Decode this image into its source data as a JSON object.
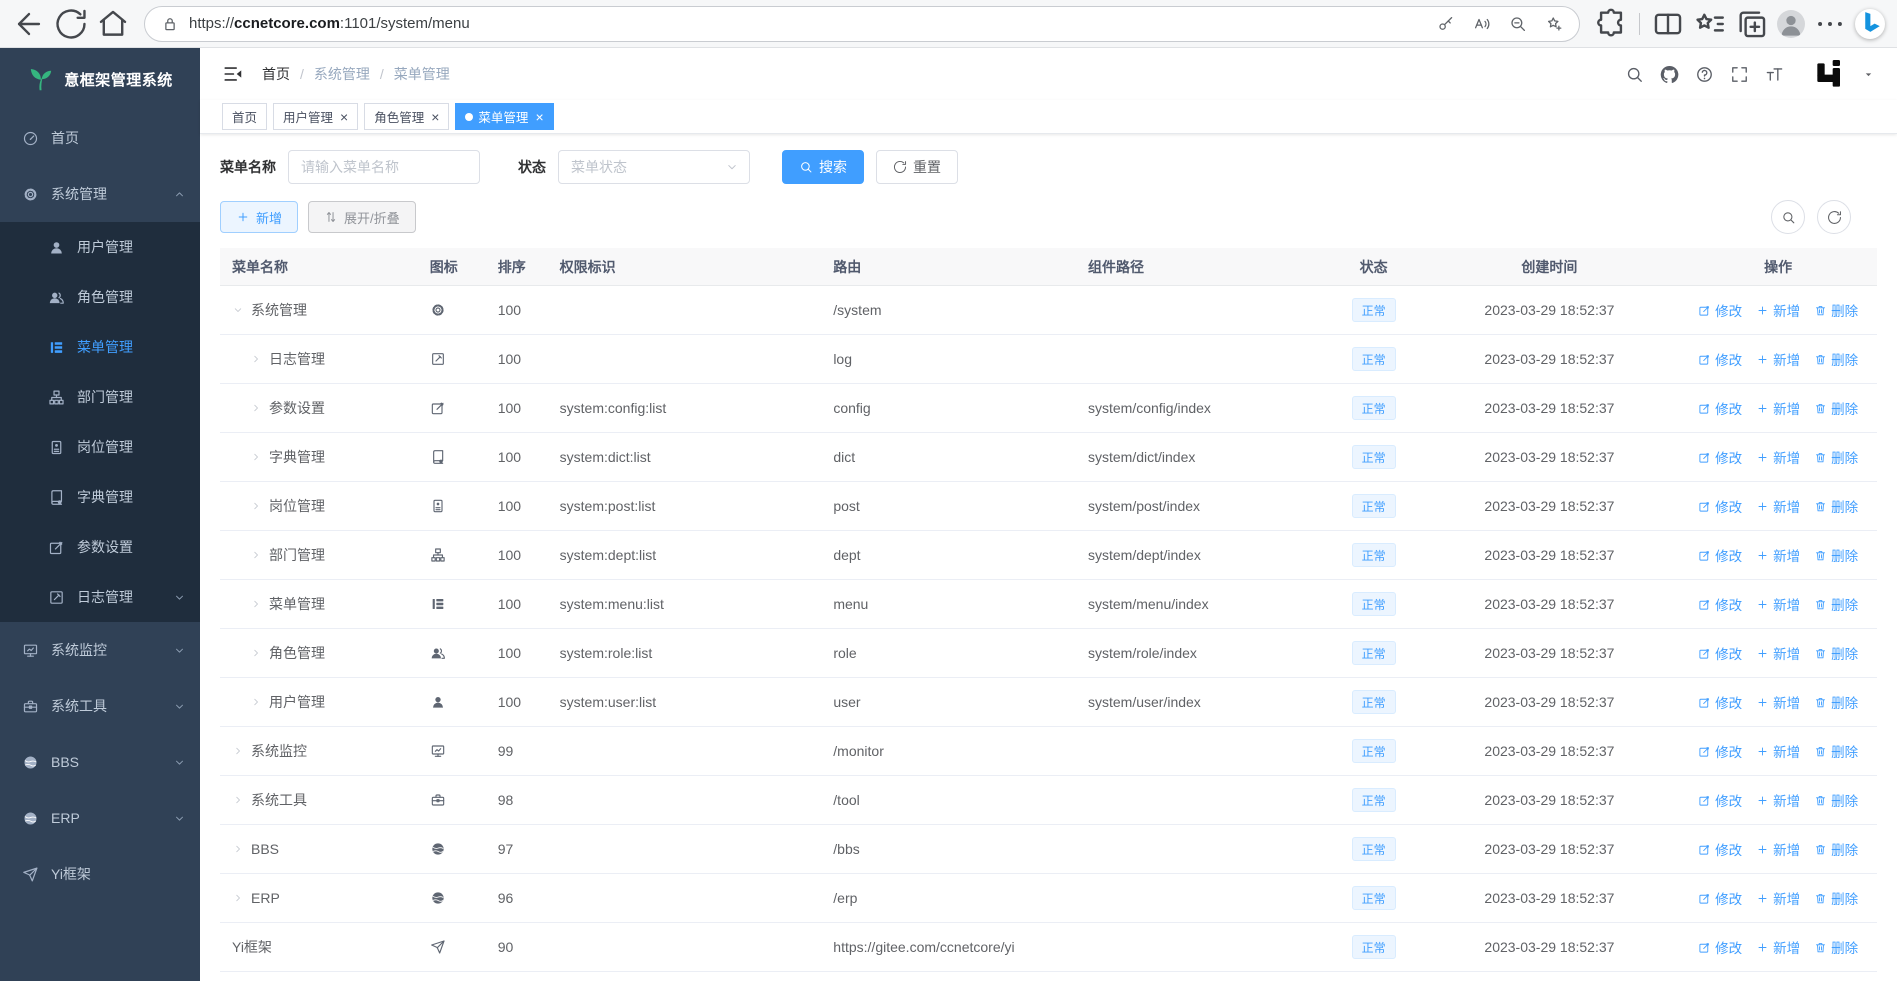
{
  "colors": {
    "accent": "#409EFF",
    "sidebar_bg": "#304156",
    "submenu_bg": "#1F2D3D",
    "status_tag_bg": "#ECF5FF",
    "logo_green": "#35B57F"
  },
  "browser": {
    "url_prefix": "https://",
    "url_domain": "ccnetcore.com",
    "url_suffix": ":1101/system/menu"
  },
  "sidebar": {
    "title": "意框架管理系统",
    "items": [
      {
        "id": "home",
        "label": "首页",
        "icon": "dashboard-icon",
        "level": 1
      },
      {
        "id": "system",
        "label": "系统管理",
        "icon": "gear-icon",
        "level": 1,
        "chevron": "up"
      },
      {
        "id": "user",
        "label": "用户管理",
        "icon": "user-icon",
        "level": 2
      },
      {
        "id": "role",
        "label": "角色管理",
        "icon": "users-icon",
        "level": 2
      },
      {
        "id": "menu",
        "label": "菜单管理",
        "icon": "menu-tree-icon",
        "level": 2,
        "active": true
      },
      {
        "id": "dept",
        "label": "部门管理",
        "icon": "org-tree-icon",
        "level": 2
      },
      {
        "id": "post",
        "label": "岗位管理",
        "icon": "id-badge-icon",
        "level": 2
      },
      {
        "id": "dict",
        "label": "字典管理",
        "icon": "dictionary-icon",
        "level": 2
      },
      {
        "id": "config",
        "label": "参数设置",
        "icon": "edit-square-icon",
        "level": 2
      },
      {
        "id": "log",
        "label": "日志管理",
        "icon": "log-edit-icon",
        "level": 2,
        "chevron": "down"
      },
      {
        "id": "monitor",
        "label": "系统监控",
        "icon": "monitor-icon",
        "level": 1,
        "chevron": "down"
      },
      {
        "id": "tool",
        "label": "系统工具",
        "icon": "toolbox-icon",
        "level": 1,
        "chevron": "down"
      },
      {
        "id": "bbs",
        "label": "BBS",
        "icon": "globe-icon",
        "level": 1,
        "chevron": "down"
      },
      {
        "id": "erp",
        "label": "ERP",
        "icon": "globe-icon",
        "level": 1,
        "chevron": "down"
      },
      {
        "id": "yi",
        "label": "Yi框架",
        "icon": "paper-plane-icon",
        "level": 1
      }
    ]
  },
  "navbar": {
    "separator": "/",
    "breadcrumb": [
      {
        "label": "首页"
      },
      {
        "label": "系统管理"
      },
      {
        "label": "菜单管理"
      }
    ]
  },
  "tabs": [
    {
      "label": "首页",
      "closable": false,
      "active": false
    },
    {
      "label": "用户管理",
      "closable": true,
      "active": false
    },
    {
      "label": "角色管理",
      "closable": true,
      "active": false
    },
    {
      "label": "菜单管理",
      "closable": true,
      "active": true
    }
  ],
  "filters": {
    "name_label": "菜单名称",
    "name_placeholder": "请输入菜单名称",
    "status_label": "状态",
    "status_placeholder": "菜单状态",
    "search_label": "搜索",
    "reset_label": "重置"
  },
  "toolbar": {
    "add_label": "新增",
    "toggle_label": "展开/折叠"
  },
  "table": {
    "columns": [
      "菜单名称",
      "图标",
      "排序",
      "权限标识",
      "路由",
      "组件路径",
      "状态",
      "创建时间",
      "操作"
    ],
    "ops": {
      "edit": "修改",
      "add": "新增",
      "delete": "删除"
    },
    "rows": [
      {
        "name": "系统管理",
        "icon": "gear-icon",
        "arrow": "down",
        "indent": false,
        "sort": "100",
        "perms": "",
        "route": "/system",
        "component": "",
        "status": "正常",
        "time": "2023-03-29 18:52:37"
      },
      {
        "name": "日志管理",
        "icon": "log-edit-icon",
        "arrow": "right",
        "indent": true,
        "sort": "100",
        "perms": "",
        "route": "log",
        "component": "",
        "status": "正常",
        "time": "2023-03-29 18:52:37"
      },
      {
        "name": "参数设置",
        "icon": "edit-square-icon",
        "arrow": "right",
        "indent": true,
        "sort": "100",
        "perms": "system:config:list",
        "route": "config",
        "component": "system/config/index",
        "status": "正常",
        "time": "2023-03-29 18:52:37"
      },
      {
        "name": "字典管理",
        "icon": "dictionary-icon",
        "arrow": "right",
        "indent": true,
        "sort": "100",
        "perms": "system:dict:list",
        "route": "dict",
        "component": "system/dict/index",
        "status": "正常",
        "time": "2023-03-29 18:52:37"
      },
      {
        "name": "岗位管理",
        "icon": "id-badge-icon",
        "arrow": "right",
        "indent": true,
        "sort": "100",
        "perms": "system:post:list",
        "route": "post",
        "component": "system/post/index",
        "status": "正常",
        "time": "2023-03-29 18:52:37"
      },
      {
        "name": "部门管理",
        "icon": "org-tree-icon",
        "arrow": "right",
        "indent": true,
        "sort": "100",
        "perms": "system:dept:list",
        "route": "dept",
        "component": "system/dept/index",
        "status": "正常",
        "time": "2023-03-29 18:52:37"
      },
      {
        "name": "菜单管理",
        "icon": "menu-tree-icon",
        "arrow": "right",
        "indent": true,
        "sort": "100",
        "perms": "system:menu:list",
        "route": "menu",
        "component": "system/menu/index",
        "status": "正常",
        "time": "2023-03-29 18:52:37"
      },
      {
        "name": "角色管理",
        "icon": "users-icon",
        "arrow": "right",
        "indent": true,
        "sort": "100",
        "perms": "system:role:list",
        "route": "role",
        "component": "system/role/index",
        "status": "正常",
        "time": "2023-03-29 18:52:37"
      },
      {
        "name": "用户管理",
        "icon": "user-icon",
        "arrow": "right",
        "indent": true,
        "sort": "100",
        "perms": "system:user:list",
        "route": "user",
        "component": "system/user/index",
        "status": "正常",
        "time": "2023-03-29 18:52:37"
      },
      {
        "name": "系统监控",
        "icon": "monitor-icon",
        "arrow": "right",
        "indent": false,
        "sort": "99",
        "perms": "",
        "route": "/monitor",
        "component": "",
        "status": "正常",
        "time": "2023-03-29 18:52:37"
      },
      {
        "name": "系统工具",
        "icon": "toolbox-icon",
        "arrow": "right",
        "indent": false,
        "sort": "98",
        "perms": "",
        "route": "/tool",
        "component": "",
        "status": "正常",
        "time": "2023-03-29 18:52:37"
      },
      {
        "name": "BBS",
        "icon": "globe-icon",
        "arrow": "right",
        "indent": false,
        "sort": "97",
        "perms": "",
        "route": "/bbs",
        "component": "",
        "status": "正常",
        "time": "2023-03-29 18:52:37"
      },
      {
        "name": "ERP",
        "icon": "globe-icon",
        "arrow": "right",
        "indent": false,
        "sort": "96",
        "perms": "",
        "route": "/erp",
        "component": "",
        "status": "正常",
        "time": "2023-03-29 18:52:37"
      },
      {
        "name": "Yi框架",
        "icon": "paper-plane-icon",
        "arrow": "none",
        "indent": false,
        "sort": "90",
        "perms": "",
        "route": "https://gitee.com/ccnetcore/yi",
        "component": "",
        "status": "正常",
        "time": "2023-03-29 18:52:37"
      }
    ]
  }
}
